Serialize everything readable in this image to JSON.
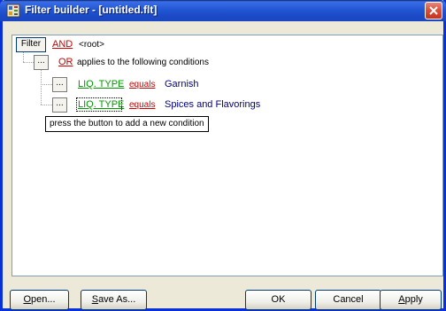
{
  "window": {
    "title": "Filter builder - [untitled.flt]"
  },
  "tree": {
    "filter_button": "Filter",
    "root_operator": "AND",
    "root_label": "<root>",
    "group": {
      "button": "...",
      "operator": "OR",
      "label": "applies to the following conditions",
      "conditions": [
        {
          "button": "...",
          "field": "LIQ. TYPE",
          "comparison": "equals",
          "value": "Garnish"
        },
        {
          "button": "...",
          "field": "LIQ. TYPE",
          "comparison": "equals",
          "value": "Spices and Flavorings"
        }
      ]
    },
    "tooltip": "press the button to add a new condition"
  },
  "buttons": {
    "open": {
      "mnemonic": "O",
      "rest": "pen..."
    },
    "save_as": {
      "mnemonic": "S",
      "rest": "ave As..."
    },
    "ok": "OK",
    "cancel": "Cancel",
    "apply": {
      "mnemonic": "A",
      "rest": "pply"
    }
  },
  "colors": {
    "titlebar": "#2559d6",
    "operator": "#cc0000",
    "field": "#009900",
    "value": "#000080"
  }
}
